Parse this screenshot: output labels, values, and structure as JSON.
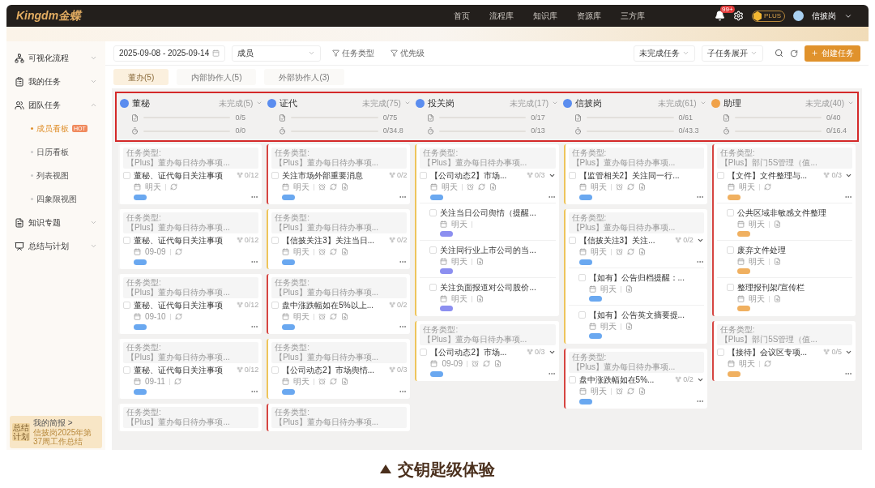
{
  "topbar": {
    "logo": "Kingdm金蝶",
    "nav": [
      "首页",
      "流程库",
      "知识库",
      "资源库",
      "三方库"
    ],
    "notification_count": "99+",
    "plus": "PLUS",
    "user": "信披岗"
  },
  "sidebar": {
    "items": [
      {
        "kind": "flow",
        "label": "可视化流程",
        "expanded": false
      },
      {
        "kind": "tasks",
        "label": "我的任务",
        "expanded": false
      },
      {
        "kind": "team",
        "label": "团队任务",
        "expanded": true,
        "children": [
          {
            "label": "成员看板",
            "badge": "HOT",
            "selected": true
          },
          {
            "label": "日历看板",
            "selected": false
          },
          {
            "label": "列表视图",
            "selected": false
          },
          {
            "label": "四象限视图",
            "selected": false
          }
        ]
      },
      {
        "kind": "knowledge",
        "label": "知识专题",
        "expanded": false
      },
      {
        "kind": "summary",
        "label": "总结与计划",
        "expanded": false
      }
    ],
    "report": {
      "badge": "总结计划",
      "title": "我的简报 >",
      "text": "信披岗2025年第37周工作总结"
    }
  },
  "toolbar": {
    "date_range": "2025-09-08 - 2025-09-14",
    "member_label": "成员",
    "filters": [
      "任务类型",
      "优先级"
    ],
    "status_select": "未完成任务",
    "subtask_select": "子任务展开",
    "create_button": "创建任务"
  },
  "tabs": [
    {
      "label": "董办(5)",
      "selected": true
    },
    {
      "label": "内部协作人(5)",
      "selected": false
    },
    {
      "label": "外部协作人(3)",
      "selected": false
    }
  ],
  "columns": [
    {
      "name": "董秘",
      "color": "#5b8def",
      "status": "未完成(5)",
      "stats": [
        {
          "kind": "tasks",
          "reading": "0/5",
          "level": 0
        },
        {
          "kind": "hours",
          "reading": "0/0",
          "level": 0
        }
      ],
      "cards": [
        {
          "kind": "plain",
          "type_label": "任务类型:",
          "type_value": "【Plus】董办每日待办事项...",
          "title": "董秘、证代每日关注事项",
          "subtask_count": "0/12",
          "date": "明天",
          "icons": [
            {
              "kind": "repeat"
            }
          ],
          "tag": {
            "color": "#6aa8f0"
          }
        },
        {
          "kind": "plain",
          "type_label": "任务类型:",
          "type_value": "【Plus】董办每日待办事项...",
          "title": "董秘、证代每日关注事项",
          "subtask_count": "0/12",
          "date": "09-09",
          "icons": [
            {
              "kind": "repeat"
            }
          ],
          "tag": {
            "color": "#6aa8f0"
          }
        },
        {
          "kind": "plain",
          "type_label": "任务类型:",
          "type_value": "【Plus】董办每日待办事项...",
          "title": "董秘、证代每日关注事项",
          "subtask_count": "0/12",
          "date": "09-10",
          "icons": [
            {
              "kind": "repeat"
            }
          ],
          "tag": {
            "color": "#6aa8f0"
          }
        },
        {
          "kind": "plain",
          "type_label": "任务类型:",
          "type_value": "【Plus】董办每日待办事项...",
          "title": "董秘、证代每日关注事项",
          "subtask_count": "0/12",
          "date": "09-11",
          "icons": [
            {
              "kind": "repeat"
            }
          ],
          "tag": {
            "color": "#6aa8f0"
          }
        },
        {
          "kind": "plain",
          "type_label": "任务类型:",
          "type_value": "【Plus】董办每日待办事项..."
        }
      ]
    },
    {
      "name": "证代",
      "color": "#5b8def",
      "status": "未完成(75)",
      "stats": [
        {
          "kind": "tasks",
          "reading": "0/75",
          "level": 0
        },
        {
          "kind": "hours",
          "reading": "0/34.8",
          "level": 0
        }
      ],
      "cards": [
        {
          "kind": "high",
          "type_label": "任务类型:",
          "type_value": "【Plus】董办每日待办事项...",
          "title": "关注市场外部重要消息",
          "subtask_count": "0/2",
          "date": "明天",
          "icons": [
            {
              "kind": "alarm"
            },
            {
              "kind": "repeat"
            },
            {
              "kind": "file"
            }
          ],
          "tag": {
            "color": "#6aa8f0"
          }
        },
        {
          "kind": "medium",
          "type_label": "任务类型:",
          "type_value": "【Plus】董办每日待办事项...",
          "title": "【信披关注3】关注当日...",
          "subtask_count": "0/2",
          "date": "明天",
          "icons": [
            {
              "kind": "alarm"
            },
            {
              "kind": "repeat"
            },
            {
              "kind": "file"
            }
          ],
          "tag": {
            "color": "#6aa8f0"
          }
        },
        {
          "kind": "high",
          "type_label": "任务类型:",
          "type_value": "【Plus】董办每日待办事项...",
          "title": "盘中涨跌幅如在5%以上...",
          "subtask_count": "0/2",
          "date": "明天",
          "icons": [
            {
              "kind": "alarm"
            },
            {
              "kind": "repeat"
            },
            {
              "kind": "file"
            }
          ],
          "tag": {
            "color": "#6aa8f0"
          }
        },
        {
          "kind": "medium",
          "type_label": "任务类型:",
          "type_value": "【Plus】董办每日待办事项...",
          "title": "【公司动态2】市场舆情...",
          "subtask_count": "0/3",
          "date": "明天",
          "icons": [
            {
              "kind": "alarm"
            },
            {
              "kind": "repeat"
            },
            {
              "kind": "file"
            }
          ],
          "tag": {
            "color": "#6aa8f0"
          }
        },
        {
          "kind": "high",
          "type_label": "任务类型:",
          "type_value": "【Plus】董办每日待办事项..."
        }
      ]
    },
    {
      "name": "投关岗",
      "color": "#5b8def",
      "status": "未完成(17)",
      "stats": [
        {
          "kind": "tasks",
          "reading": "0/17",
          "level": 0
        },
        {
          "kind": "hours",
          "reading": "0/13",
          "level": 0
        }
      ],
      "cards": [
        {
          "kind": "medium",
          "type_label": "任务类型:",
          "type_value": "【Plus】董办每日待办事项...",
          "title": "【公司动态2】市场...",
          "subtask_count": "0/3",
          "expanded": true,
          "date": "明天",
          "icons": [
            {
              "kind": "alarm"
            },
            {
              "kind": "repeat"
            },
            {
              "kind": "file"
            }
          ],
          "tag": {
            "color": "#6aa8f0"
          },
          "subtasks": [
            {
              "title": "关注当日公司舆情（提醒...",
              "date": "明天",
              "tag": {
                "color": "#8c8ff0"
              }
            },
            {
              "title": "关注同行业上市公司的当...",
              "date": "明天",
              "icons": [
                {
                  "kind": "file"
                }
              ],
              "tag": {
                "color": "#8c8ff0"
              }
            },
            {
              "title": "关注负面报道对公司股价...",
              "date": "明天",
              "icons": [
                {
                  "kind": "file"
                }
              ],
              "tag": {
                "color": "#8c8ff0"
              }
            }
          ]
        },
        {
          "kind": "medium",
          "type_label": "任务类型:",
          "type_value": "【Plus】董办每日待办事项...",
          "title": "【公司动态2】市场...",
          "subtask_count": "0/3",
          "expanded": true,
          "date": "09-09",
          "icons": [
            {
              "kind": "alarm"
            },
            {
              "kind": "repeat"
            },
            {
              "kind": "file"
            }
          ],
          "tag": {
            "color": "#6aa8f0"
          }
        }
      ]
    },
    {
      "name": "信披岗",
      "color": "#5b8def",
      "status": "未完成(61)",
      "stats": [
        {
          "kind": "tasks",
          "reading": "0/61",
          "level": 0
        },
        {
          "kind": "hours",
          "reading": "0/43.3",
          "level": 0
        }
      ],
      "cards": [
        {
          "kind": "medium",
          "type_label": "任务类型:",
          "type_value": "【Plus】董办每日待办事项...",
          "title": "【监管相关2】关注同一行...",
          "date": "明天",
          "icons": [
            {
              "kind": "alarm"
            },
            {
              "kind": "repeat"
            },
            {
              "kind": "file"
            }
          ],
          "tag": {
            "color": "#6aa8f0"
          }
        },
        {
          "kind": "medium",
          "type_label": "任务类型:",
          "type_value": "【Plus】董办每日待办事项...",
          "title": "【信披关注3】关注...",
          "subtask_count": "0/2",
          "expanded": true,
          "date": "明天",
          "icons": [
            {
              "kind": "alarm"
            },
            {
              "kind": "repeat"
            },
            {
              "kind": "file"
            }
          ],
          "tag": {
            "color": "#6aa8f0"
          },
          "subtasks": [
            {
              "title": "【如有】公告归档提醒：...",
              "date": "明天",
              "icons": [
                {
                  "kind": "file"
                }
              ],
              "tag": {
                "color": "#6aa8f0"
              }
            },
            {
              "title": "【如有】公告英文摘要提...",
              "date": "明天",
              "icons": [
                {
                  "kind": "file"
                }
              ],
              "tag": {
                "color": "#6aa8f0"
              }
            }
          ]
        },
        {
          "kind": "high",
          "type_label": "任务类型:",
          "type_value": "【Plus】董办每日待办事项...",
          "title": "盘中涨跌幅如在5%...",
          "subtask_count": "0/2",
          "expanded": true,
          "date": "明天",
          "icons": [
            {
              "kind": "alarm"
            },
            {
              "kind": "repeat"
            },
            {
              "kind": "file"
            }
          ],
          "tag": {
            "color": "#6aa8f0"
          }
        }
      ]
    },
    {
      "name": "助理",
      "color": "#f0a24a",
      "status": "未完成(40)",
      "stats": [
        {
          "kind": "tasks",
          "reading": "0/40",
          "level": 0
        },
        {
          "kind": "hours",
          "reading": "0/16.4",
          "level": 0
        }
      ],
      "cards": [
        {
          "kind": "high",
          "type_label": "任务类型:",
          "type_value": "【Plus】部门5S管理（值...",
          "title": "【文件】文件整理与...",
          "subtask_count": "0/3",
          "expanded": true,
          "date": "明天",
          "icons": [
            {
              "kind": "repeat"
            }
          ],
          "tag": {
            "color": "#f0b060"
          },
          "subtasks": [
            {
              "title": "公共区域非敏感文件整理",
              "date": "明天",
              "icons": [
                {
                  "kind": "file"
                }
              ],
              "tag": {
                "color": "#f0b060"
              }
            },
            {
              "title": "废弃文件处理",
              "date": "明天",
              "icons": [
                {
                  "kind": "file"
                }
              ],
              "tag": {
                "color": "#f0b060"
              }
            },
            {
              "title": "整理报刊架/宣传栏",
              "date": "明天",
              "icons": [
                {
                  "kind": "file"
                }
              ],
              "tag": {
                "color": "#f0b060"
              }
            }
          ]
        },
        {
          "kind": "high",
          "type_label": "任务类型:",
          "type_value": "【Plus】部门5S管理（值...",
          "title": "【接待】会议区专项...",
          "subtask_count": "0/5",
          "expanded": true,
          "date": "明天",
          "icons": [
            {
              "kind": "repeat"
            }
          ],
          "tag": {
            "color": "#f0b060"
          }
        }
      ]
    }
  ],
  "caption": "交钥匙级体验"
}
